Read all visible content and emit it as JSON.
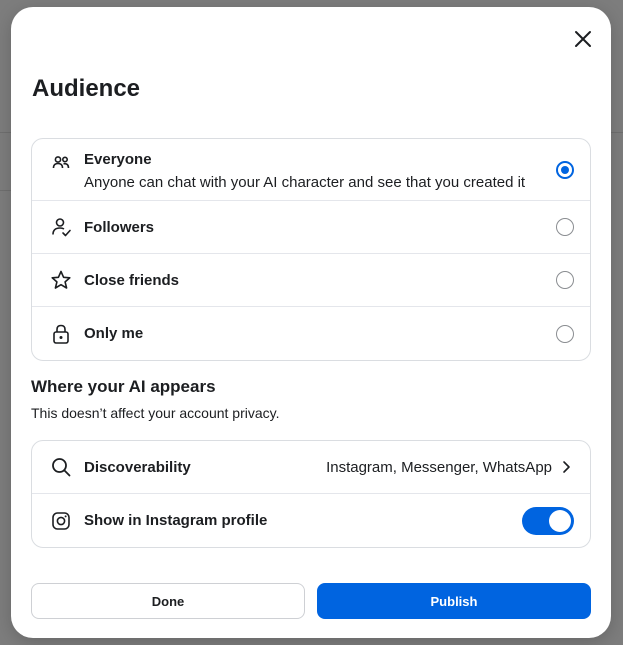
{
  "modal": {
    "title": "Audience",
    "close_icon": "close-icon"
  },
  "audience": {
    "selected": "everyone",
    "options": [
      {
        "id": "everyone",
        "label": "Everyone",
        "description": "Anyone can chat with your AI character and see that you created it",
        "icon": "people-icon"
      },
      {
        "id": "followers",
        "label": "Followers",
        "icon": "follower-icon"
      },
      {
        "id": "close_friends",
        "label": "Close friends",
        "icon": "star-icon"
      },
      {
        "id": "only_me",
        "label": "Only me",
        "icon": "lock-icon"
      }
    ]
  },
  "where": {
    "title": "Where your AI appears",
    "subtitle": "This doesn’t affect your account privacy.",
    "discoverability": {
      "label": "Discoverability",
      "value": "Instagram, Messenger, WhatsApp",
      "icon": "search-icon"
    },
    "instagram_profile": {
      "label": "Show in Instagram profile",
      "enabled": true,
      "icon": "instagram-icon"
    }
  },
  "buttons": {
    "done": "Done",
    "publish": "Publish"
  },
  "colors": {
    "accent": "#0064e0",
    "border": "#dadde1"
  }
}
